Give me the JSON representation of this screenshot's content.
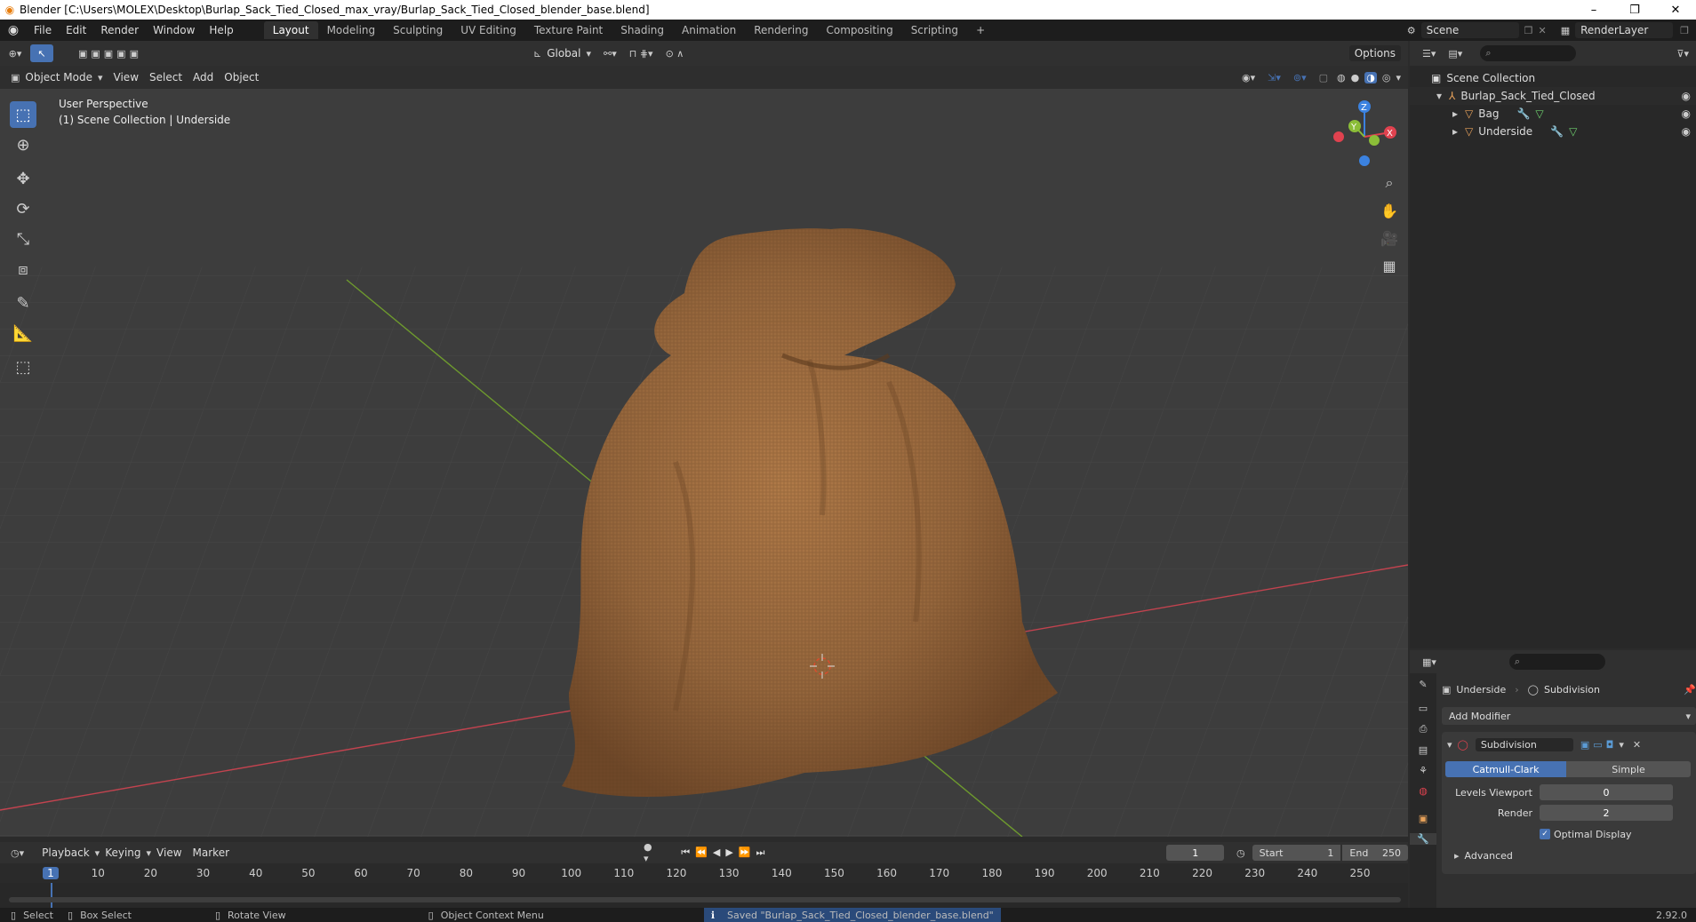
{
  "window": {
    "title": "Blender [C:\\Users\\MOLEX\\Desktop\\Burlap_Sack_Tied_Closed_max_vray/Burlap_Sack_Tied_Closed_blender_base.blend]",
    "minimize": "–",
    "maximize": "❐",
    "close": "✕"
  },
  "menus": [
    "File",
    "Edit",
    "Render",
    "Window",
    "Help"
  ],
  "workspaces": [
    "Layout",
    "Modeling",
    "Sculpting",
    "UV Editing",
    "Texture Paint",
    "Shading",
    "Animation",
    "Rendering",
    "Compositing",
    "Scripting"
  ],
  "scene": {
    "name": "Scene",
    "render_layer": "RenderLayer"
  },
  "viewport_header": {
    "mode": "Object Mode",
    "menus": [
      "View",
      "Select",
      "Add",
      "Object"
    ],
    "orientation": "Global",
    "options": "Options"
  },
  "viewport": {
    "perspective": "User Perspective",
    "collection_info": "(1) Scene Collection | Underside",
    "axis_x": "X",
    "axis_y": "Y",
    "axis_z": "Z"
  },
  "outliner": {
    "root": "Scene Collection",
    "collection": "Burlap_Sack_Tied_Closed",
    "objects": [
      "Bag",
      "Underside"
    ]
  },
  "properties": {
    "object": "Underside",
    "modifier_breadcrumb": "Subdivision",
    "add_modifier": "Add Modifier",
    "modifier_name": "Subdivision",
    "algo_tabs": [
      "Catmull-Clark",
      "Simple"
    ],
    "levels_viewport_label": "Levels Viewport",
    "levels_viewport_value": "0",
    "render_label": "Render",
    "render_value": "2",
    "optimal_display": "Optimal Display",
    "advanced": "Advanced"
  },
  "timeline": {
    "menus": [
      "Playback",
      "Keying",
      "View",
      "Marker"
    ],
    "current_frame": "1",
    "start_label": "Start",
    "start_value": "1",
    "end_label": "End",
    "end_value": "250",
    "ticks": [
      "1",
      "10",
      "20",
      "30",
      "40",
      "50",
      "60",
      "70",
      "80",
      "90",
      "100",
      "110",
      "120",
      "130",
      "140",
      "150",
      "160",
      "170",
      "180",
      "190",
      "200",
      "210",
      "220",
      "230",
      "240",
      "250"
    ]
  },
  "status": {
    "select": "Select",
    "box_select": "Box Select",
    "rotate_view": "Rotate View",
    "context_menu": "Object Context Menu",
    "message": "Saved \"Burlap_Sack_Tied_Closed_blender_base.blend\"",
    "version": "2.92.0"
  },
  "colors": {
    "accent": "#4772b3",
    "x_axis": "#e0424f",
    "y_axis": "#8bbd38",
    "z_axis": "#3b82e0",
    "sack": "#9a6a3e"
  }
}
